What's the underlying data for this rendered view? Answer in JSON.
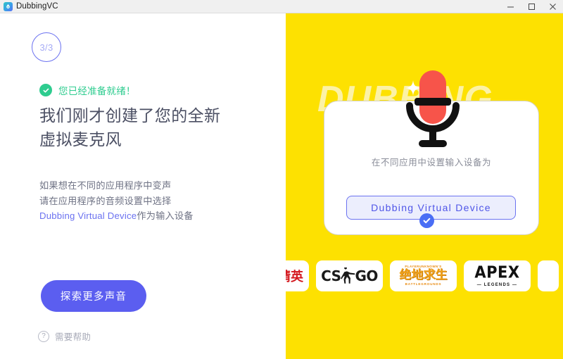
{
  "window": {
    "title": "DubbingVC",
    "app_icon": "dubbing-droplet-icon",
    "controls": {
      "minimize": "minimize-icon",
      "maximize": "maximize-icon",
      "close": "close-icon"
    }
  },
  "colors": {
    "accent_blue": "#5b5ef0",
    "accent_blue_text": "#4f55e8",
    "success_green": "#2ecc8f",
    "panel_yellow": "#FDE101",
    "watermark_yellow": "#fcf2a6",
    "mic_red": "#F7544A",
    "check_badge_blue": "#4a6ef5",
    "heading_gray": "#4b4f63",
    "body_gray": "#6f7385",
    "muted_gray": "#a8abb8"
  },
  "left": {
    "step_badge": "3/3",
    "ready_icon": "check-circle-icon",
    "ready_text": "您已经准备就绪！",
    "headline_line1": "我们刚才创建了您的全新",
    "headline_line2": "虚拟麦克风",
    "body_line1": "如果想在不同的应用程序中变声",
    "body_line2": "请在应用程序的音频设置中选择",
    "body_line3_link": "Dubbing Virtual Device",
    "body_line3_rest": "作为输入设备",
    "cta_label": "探索更多声音",
    "help_icon": "question-mark-icon",
    "help_label": "需要帮助"
  },
  "right": {
    "watermark": "DUBBING",
    "mic_icon": "microphone-icon",
    "sparkle_icon": "sparkle-icon",
    "card": {
      "caption": "在不同应用中设置输入设备为",
      "device_name": "Dubbing  Virtual  Device",
      "selected_icon": "check-circle-icon"
    },
    "logos": [
      {
        "name": "logo-cn-partial",
        "kind": "cn-red",
        "text": "精英",
        "partial": true
      },
      {
        "name": "logo-csgo",
        "kind": "csgo",
        "text_left": "CS",
        "text_right": "GO",
        "partial": false
      },
      {
        "name": "logo-pubg",
        "kind": "pubg",
        "top": "PLAYERUNKNOWN'S",
        "mid": "绝地求生",
        "bottom": "BATTLEGROUNDS",
        "partial": false
      },
      {
        "name": "logo-apex",
        "kind": "apex",
        "title": "APEX",
        "sub": "— LEGENDS —",
        "partial": false
      },
      {
        "name": "logo-next-partial",
        "kind": "blank",
        "text": "",
        "partial": true
      }
    ]
  }
}
